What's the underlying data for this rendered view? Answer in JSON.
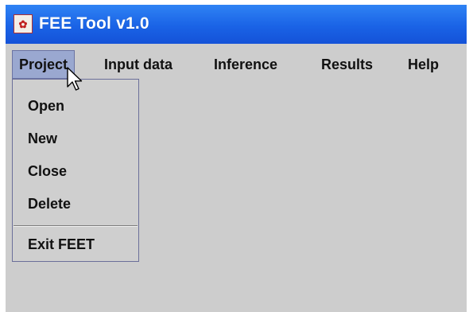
{
  "window": {
    "title": "FEE  Tool v1.0",
    "icon": "app-logo-icon"
  },
  "menubar": {
    "items": [
      {
        "label": "Project",
        "active": true
      },
      {
        "label": "Input data"
      },
      {
        "label": "Inference"
      },
      {
        "label": "Results"
      },
      {
        "label": "Help"
      }
    ]
  },
  "project_menu": {
    "items": [
      {
        "label": "Open"
      },
      {
        "label": "New"
      },
      {
        "label": "Close"
      },
      {
        "label": "Delete"
      },
      {
        "label": "Exit FEET"
      }
    ]
  },
  "cursor": {
    "icon": "arrow-pointer-icon"
  },
  "colors": {
    "titlebar": "#1a63e6",
    "window_bg": "#cdcdcd",
    "menu_highlight": "#9aa8d0"
  }
}
